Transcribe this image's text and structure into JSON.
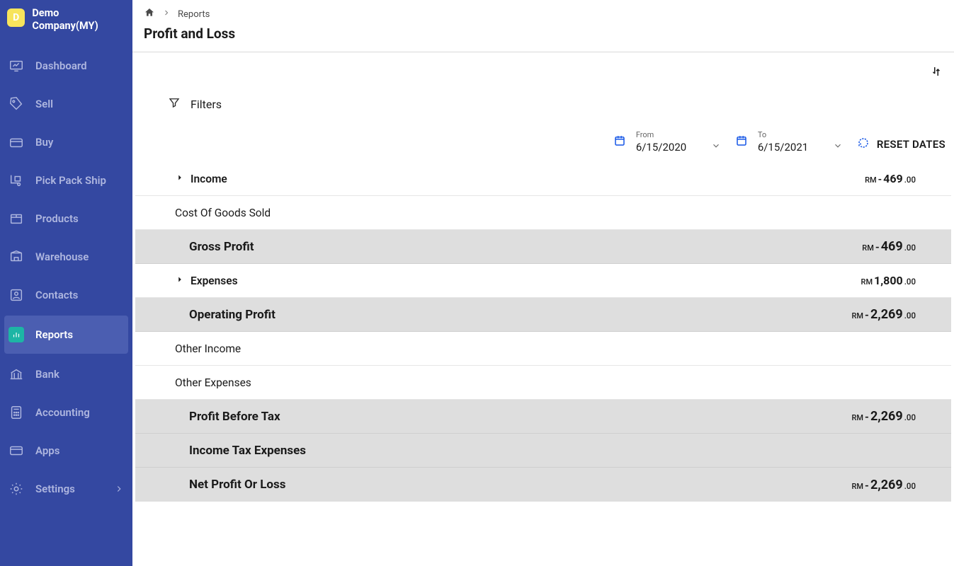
{
  "company": {
    "logo_letter": "D",
    "name": "Demo Company(MY)"
  },
  "sidebar": {
    "items": [
      {
        "icon": "dashboard",
        "label": "Dashboard"
      },
      {
        "icon": "sell",
        "label": "Sell"
      },
      {
        "icon": "buy",
        "label": "Buy"
      },
      {
        "icon": "pps",
        "label": "Pick Pack Ship"
      },
      {
        "icon": "products",
        "label": "Products"
      },
      {
        "icon": "warehouse",
        "label": "Warehouse"
      },
      {
        "icon": "contacts",
        "label": "Contacts"
      },
      {
        "icon": "reports",
        "label": "Reports",
        "active": true
      },
      {
        "icon": "bank",
        "label": "Bank"
      },
      {
        "icon": "accounting",
        "label": "Accounting"
      },
      {
        "icon": "apps",
        "label": "Apps"
      },
      {
        "icon": "settings",
        "label": "Settings",
        "hasChevron": true
      }
    ]
  },
  "breadcrumb": {
    "current": "Reports"
  },
  "page": {
    "title": "Profit and Loss"
  },
  "filters": {
    "label": "Filters"
  },
  "dates": {
    "from_label": "From",
    "from_value": "6/15/2020",
    "to_label": "To",
    "to_value": "6/15/2021",
    "reset_label": "RESET DATES"
  },
  "currency": "RM",
  "rows": {
    "income": {
      "label": "Income",
      "neg": true,
      "num": "469",
      "dec": ".00"
    },
    "cogs": {
      "label": "Cost Of Goods Sold"
    },
    "gross_profit": {
      "label": "Gross Profit",
      "neg": true,
      "num": "469",
      "dec": ".00"
    },
    "expenses": {
      "label": "Expenses",
      "neg": false,
      "num": "1,800",
      "dec": ".00"
    },
    "op_profit": {
      "label": "Operating Profit",
      "neg": true,
      "num": "2,269",
      "dec": ".00"
    },
    "other_income": {
      "label": "Other Income"
    },
    "other_exp": {
      "label": "Other Expenses"
    },
    "pbt": {
      "label": "Profit Before Tax",
      "neg": true,
      "num": "2,269",
      "dec": ".00"
    },
    "tax": {
      "label": "Income Tax Expenses"
    },
    "net": {
      "label": "Net Profit Or Loss",
      "neg": true,
      "num": "2,269",
      "dec": ".00"
    }
  }
}
